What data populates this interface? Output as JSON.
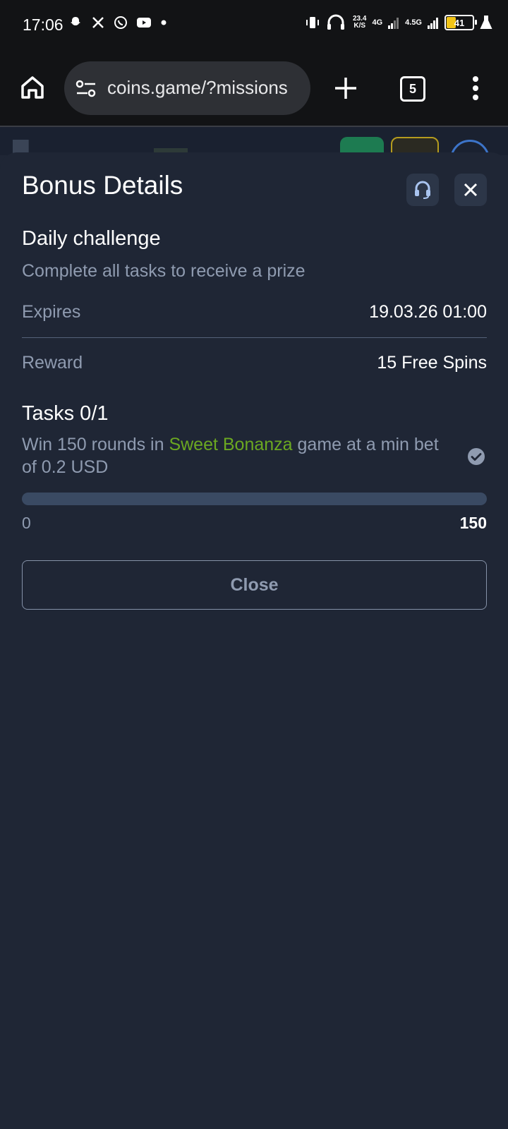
{
  "status_bar": {
    "time": "17:06",
    "notification_icons": [
      "snapchat-icon",
      "x-icon",
      "whatsapp-icon",
      "youtube-icon",
      "dot-icon"
    ],
    "net_speed_value": "23.4",
    "net_speed_unit": "K/S",
    "net_4g": "4G",
    "net_45g": "4.5G",
    "battery_level": "41"
  },
  "browser": {
    "url": "coins.game/?missions",
    "tab_count": "5"
  },
  "modal": {
    "title": "Bonus Details",
    "challenge_name": "Daily challenge",
    "challenge_desc": "Complete all tasks to receive a prize",
    "expires_label": "Expires",
    "expires_value": "19.03.26 01:00",
    "reward_label": "Reward",
    "reward_value": "15 Free Spins",
    "tasks_title": "Tasks 0/1",
    "task": {
      "prefix": "Win 150 rounds in ",
      "game": "Sweet Bonanza",
      "suffix": " game at a min bet of 0.2 USD",
      "progress_current": 0,
      "progress_min_label": "0",
      "progress_max_label": "150",
      "progress_fraction": 0
    },
    "close_label": "Close"
  },
  "colors": {
    "background": "#1f2635",
    "accent_game": "#6ba821",
    "muted_text": "#8f9bb0",
    "progress_track": "#3a4a63"
  }
}
